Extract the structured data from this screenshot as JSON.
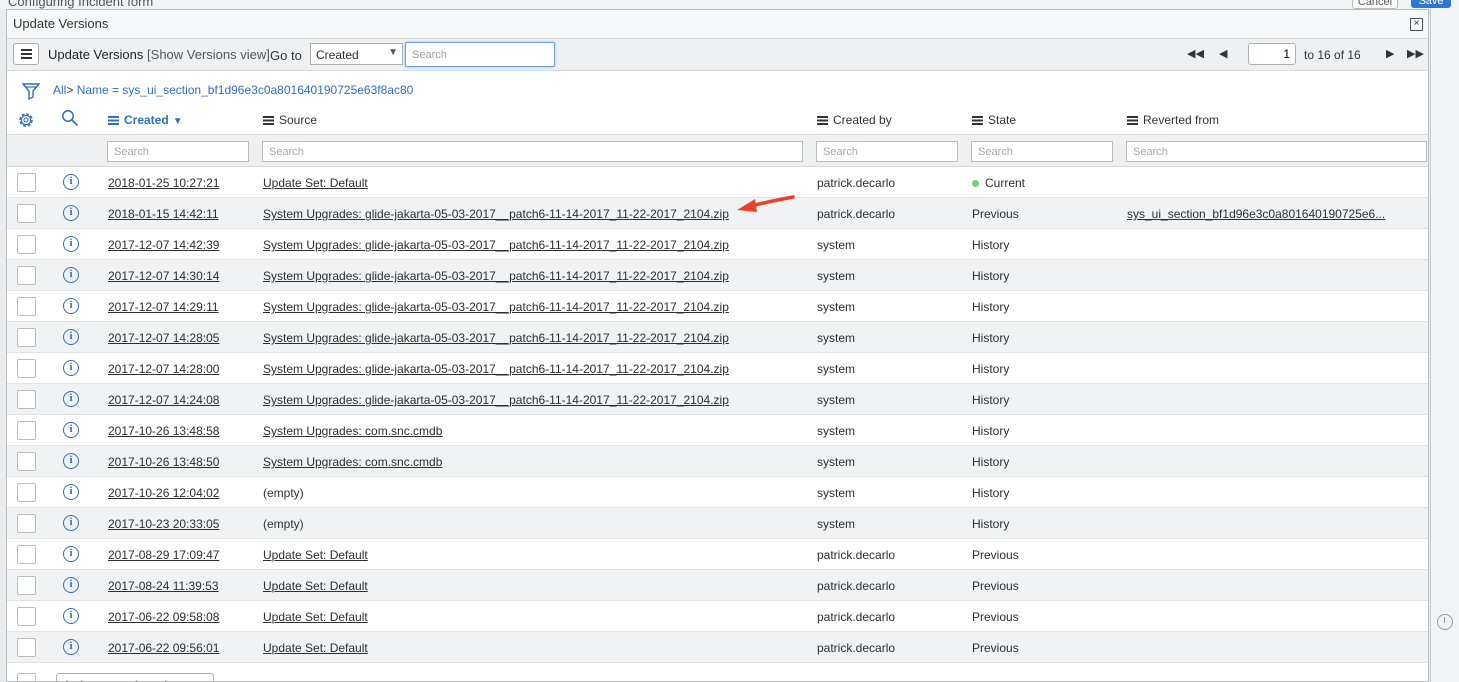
{
  "background_form": {
    "title": "Configuring Incident form",
    "cancel_label": "Cancel",
    "save_label": "Save"
  },
  "modal": {
    "title": "Update Versions",
    "close_label": "×"
  },
  "toolbar": {
    "list_title": "Update Versions",
    "view_label": "[Show Versions view]",
    "goto_label": "Go to",
    "goto_value": "Created",
    "search_placeholder": "Search"
  },
  "pager": {
    "first": "◀◀",
    "prev": "◀",
    "current": "1",
    "total_text": "to 16 of 16",
    "next": "▶",
    "last": "▶▶"
  },
  "breadcrumb": {
    "all": "All",
    "sep": ">",
    "filter": "Name = sys_ui_section_bf1d96e3c0a801640190725e63f8ac80"
  },
  "columns": [
    {
      "label": "Created",
      "search": "Search"
    },
    {
      "label": "Source",
      "search": "Search"
    },
    {
      "label": "Created by",
      "search": "Search"
    },
    {
      "label": "State",
      "search": "Search"
    },
    {
      "label": "Reverted from",
      "search": "Search"
    }
  ],
  "rows": [
    {
      "created": "2018-01-25 10:27:21",
      "source": "Update Set: Default",
      "created_by": "patrick.decarlo",
      "state": "Current",
      "reverted_from": ""
    },
    {
      "created": "2018-01-15 14:42:11",
      "source": "System Upgrades: glide-jakarta-05-03-2017__patch6-11-14-2017_11-22-2017_2104.zip",
      "created_by": "patrick.decarlo",
      "state": "Previous",
      "reverted_from": "sys_ui_section_bf1d96e3c0a801640190725e6..."
    },
    {
      "created": "2017-12-07 14:42:39",
      "source": "System Upgrades: glide-jakarta-05-03-2017__patch6-11-14-2017_11-22-2017_2104.zip",
      "created_by": "system",
      "state": "History",
      "reverted_from": ""
    },
    {
      "created": "2017-12-07 14:30:14",
      "source": "System Upgrades: glide-jakarta-05-03-2017__patch6-11-14-2017_11-22-2017_2104.zip",
      "created_by": "system",
      "state": "History",
      "reverted_from": ""
    },
    {
      "created": "2017-12-07 14:29:11",
      "source": "System Upgrades: glide-jakarta-05-03-2017__patch6-11-14-2017_11-22-2017_2104.zip",
      "created_by": "system",
      "state": "History",
      "reverted_from": ""
    },
    {
      "created": "2017-12-07 14:28:05",
      "source": "System Upgrades: glide-jakarta-05-03-2017__patch6-11-14-2017_11-22-2017_2104.zip",
      "created_by": "system",
      "state": "History",
      "reverted_from": ""
    },
    {
      "created": "2017-12-07 14:28:00",
      "source": "System Upgrades: glide-jakarta-05-03-2017__patch6-11-14-2017_11-22-2017_2104.zip",
      "created_by": "system",
      "state": "History",
      "reverted_from": ""
    },
    {
      "created": "2017-12-07 14:24:08",
      "source": "System Upgrades: glide-jakarta-05-03-2017__patch6-11-14-2017_11-22-2017_2104.zip",
      "created_by": "system",
      "state": "History",
      "reverted_from": ""
    },
    {
      "created": "2017-10-26 13:48:58",
      "source": "System Upgrades: com.snc.cmdb",
      "created_by": "system",
      "state": "History",
      "reverted_from": ""
    },
    {
      "created": "2017-10-26 13:48:50",
      "source": "System Upgrades: com.snc.cmdb",
      "created_by": "system",
      "state": "History",
      "reverted_from": ""
    },
    {
      "created": "2017-10-26 12:04:02",
      "source": "(empty)",
      "created_by": "system",
      "state": "History",
      "reverted_from": ""
    },
    {
      "created": "2017-10-23 20:33:05",
      "source": "(empty)",
      "created_by": "system",
      "state": "History",
      "reverted_from": ""
    },
    {
      "created": "2017-08-29 17:09:47",
      "source": "Update Set: Default",
      "created_by": "patrick.decarlo",
      "state": "Previous",
      "reverted_from": ""
    },
    {
      "created": "2017-08-24 11:39:53",
      "source": "Update Set: Default",
      "created_by": "patrick.decarlo",
      "state": "Previous",
      "reverted_from": ""
    },
    {
      "created": "2017-06-22 09:58:08",
      "source": "Update Set: Default",
      "created_by": "patrick.decarlo",
      "state": "Previous",
      "reverted_from": ""
    },
    {
      "created": "2017-06-22 09:56:01",
      "source": "Update Set: Default",
      "created_by": "patrick.decarlo",
      "state": "Previous",
      "reverted_from": ""
    }
  ],
  "footer": {
    "actions_label": "Actions on selected rows..."
  },
  "colors": {
    "link_blue": "#2f6fbd",
    "current_dot": "#71d17e",
    "annotation_arrow": "#e8432a"
  },
  "icons": {
    "menu": "hamburger-menu-icon",
    "filter": "funnel-icon",
    "gear": "gear-icon",
    "search": "magnifier-icon",
    "info": "info-circle-icon"
  }
}
